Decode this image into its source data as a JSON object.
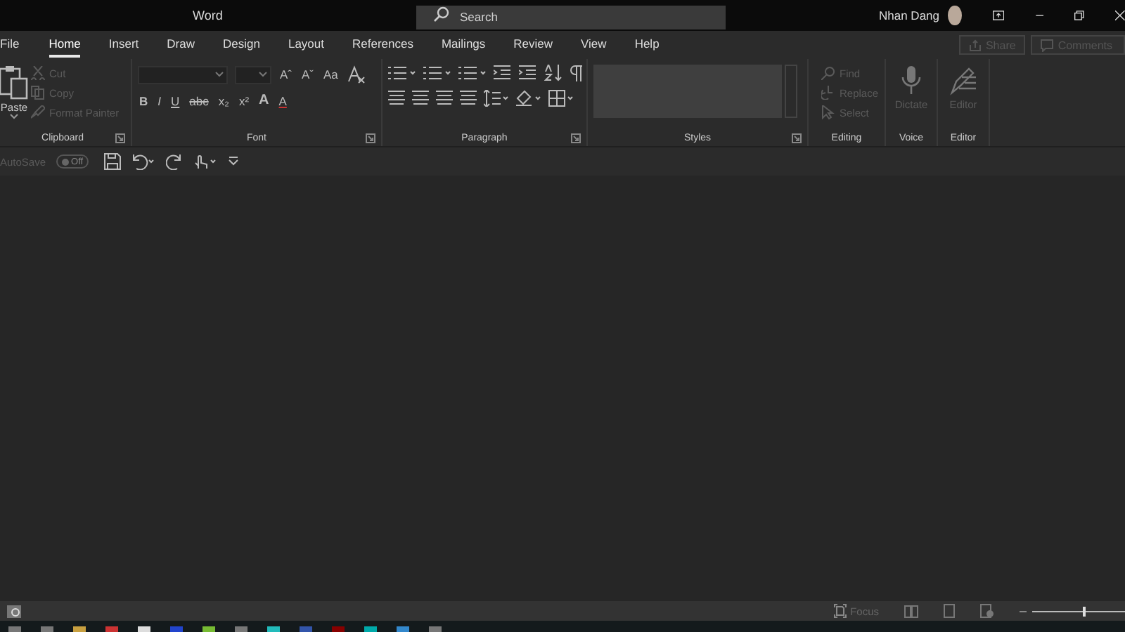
{
  "window": {
    "title": "Word",
    "search": {
      "placeholder": "Search"
    },
    "user": "Nhan Dang"
  },
  "tabs": [
    {
      "label": "File",
      "selected": false
    },
    {
      "label": "Home",
      "selected": true
    },
    {
      "label": "Insert",
      "selected": false
    },
    {
      "label": "Draw",
      "selected": false
    },
    {
      "label": "Design",
      "selected": false
    },
    {
      "label": "Layout",
      "selected": false
    },
    {
      "label": "References",
      "selected": false
    },
    {
      "label": "Mailings",
      "selected": false
    },
    {
      "label": "Review",
      "selected": false
    },
    {
      "label": "View",
      "selected": false
    },
    {
      "label": "Help",
      "selected": false
    }
  ],
  "share": {
    "label": "Share",
    "disabled": true
  },
  "comments": {
    "label": "Comments",
    "disabled": true
  },
  "clipboard": {
    "title": "Clipboard",
    "paste": "Paste",
    "items": [
      {
        "label": "Cut",
        "disabled": true
      },
      {
        "label": "Copy",
        "disabled": true
      },
      {
        "label": "Format Painter",
        "disabled": true
      }
    ]
  },
  "font": {
    "title": "Font",
    "row1": [
      "Aˆ",
      "Aˇ",
      "Aa"
    ],
    "row2": [
      "B",
      "I",
      "U",
      "abc",
      "x₂",
      "x²",
      "A",
      "A"
    ]
  },
  "paragraph": {
    "title": "Paragraph"
  },
  "styles": {
    "title": "Styles"
  },
  "editing": {
    "title": "Editing",
    "items": [
      {
        "label": "Find",
        "disabled": true
      },
      {
        "label": "Replace",
        "disabled": true
      },
      {
        "label": "Select",
        "disabled": true
      }
    ]
  },
  "voice": {
    "title": "Voice",
    "label": "Dictate",
    "disabled": true
  },
  "editor": {
    "title": "Editor",
    "label": "Editor",
    "disabled": true
  },
  "quick_access": {
    "autosave": "AutoSave",
    "toggle": "Off",
    "on": false
  },
  "status_bar": {
    "focus": "Focus",
    "zoom": {
      "level": 0.55
    }
  }
}
